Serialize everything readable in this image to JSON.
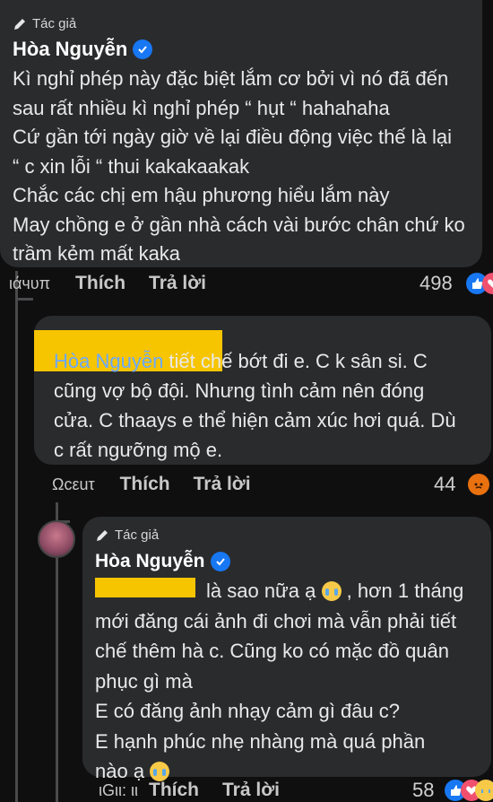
{
  "comment1": {
    "badge": "Tác giả",
    "name": "Hòa Nguyễn",
    "lines": [
      "Kì nghỉ phép này đặc biệt lắm cơ bởi vì nó đã đến",
      "sau rất nhiều kì nghỉ phép “ hụt “ hahahaha",
      "Cứ gần tới ngày giờ về lại điều động việc thế là lại",
      "“ c xin lỗi “ thui kakakaakak",
      "Chắc các chị em hậu phương hiểu lắm này",
      "May chồng e ở gần nhà cách vài bước chân chứ ko",
      "trầm kẻm mất kaka"
    ],
    "time": "ιάчυπ",
    "like": "Thích",
    "reply": "Trả lời",
    "reactions": "498"
  },
  "comment2": {
    "mention": "Hòa Nguyễn",
    "lines": [
      " tiết chế bớt đi e. C k sân si. C",
      "cũng vợ bộ đội. Nhưng tình cảm nên đóng",
      "cửa. C thaays e thể hiện cảm xúc hơi quá. Dù",
      "c rất ngưỡng mộ e."
    ],
    "time": "Ωcεuτ",
    "like": "Thích",
    "reply": "Trả lời",
    "reactions": "44"
  },
  "comment3": {
    "badge": "Tác giả",
    "name": "Hòa Nguyễn",
    "lines": [
      "là sao nữa ạ",
      ", hơn 1 tháng",
      "mới đăng cái ảnh đi chơi mà vẫn phải tiết",
      "chế thêm hà c. Cũng ko có mặc đồ quân",
      "phục gì mà",
      "E có đăng ảnh nhạy cảm gì đâu c?",
      "E hạnh phúc nhẹ nhàng mà quá phần",
      "nào ạ"
    ],
    "time": "ιGιι: ιι",
    "like": "Thích",
    "reply": "Trả lời",
    "reactions": "58"
  },
  "colors": {
    "bubble": "#2a2b2d",
    "background": "#0f0f10",
    "link": "#6aa9ff",
    "verified": "#1877f2",
    "highlight": "#f7c400"
  }
}
